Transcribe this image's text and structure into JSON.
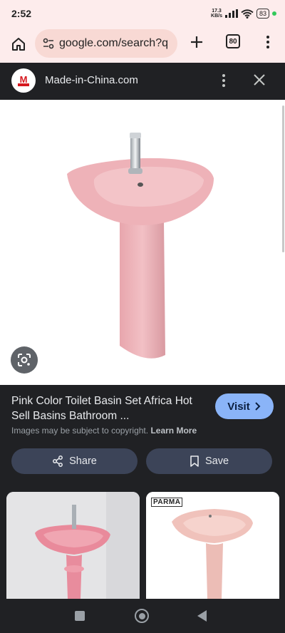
{
  "status_bar": {
    "time": "2:52",
    "net_speed_value": "17.3",
    "net_speed_unit": "KB/s",
    "battery": "83"
  },
  "browser": {
    "url": "google.com/search?q",
    "tab_count": "80",
    "toolbar_bg": "#fdecec"
  },
  "viewer": {
    "site_name": "Made-in-China.com",
    "logo_letter": "M",
    "product_title": "Pink Color Toilet Basin Set Africa Hot Sell Basins Bathroom ...",
    "visit_label": "Visit",
    "copyright_text": "Images may be subject to copyright.",
    "learn_more_label": "Learn More",
    "share_label": "Share",
    "save_label": "Save",
    "accent": "#8ab4f8"
  },
  "related": [
    {
      "badge": ""
    },
    {
      "badge": "PARMA"
    }
  ],
  "icons": {
    "home": "home-icon",
    "tune": "tune-icon",
    "plus": "plus-icon",
    "menu": "more-vert-icon",
    "close": "close-icon",
    "lens": "lens-icon",
    "share": "share-icon",
    "bookmark": "bookmark-icon",
    "chevron": "chevron-right-icon"
  }
}
